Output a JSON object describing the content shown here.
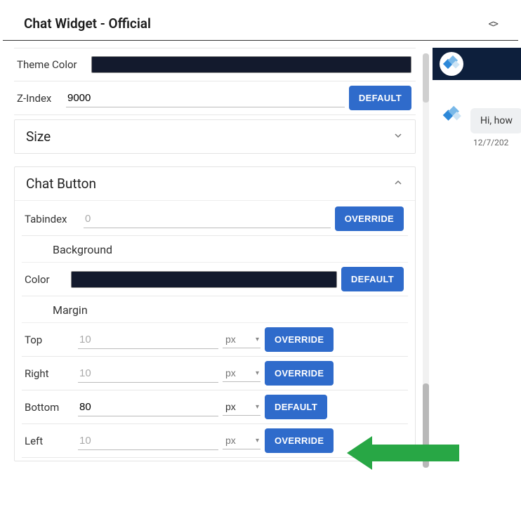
{
  "header": {
    "title": "Chat Widget - Official"
  },
  "fields": {
    "theme_color_label": "Theme Color",
    "theme_color_value": "#131a2d",
    "zindex_label": "Z-Index",
    "zindex_value": "9000",
    "zindex_btn": "DEFAULT"
  },
  "sections": {
    "size": {
      "title": "Size",
      "expanded": false
    },
    "chat_button": {
      "title": "Chat Button",
      "expanded": true,
      "tabindex_label": "Tabindex",
      "tabindex_placeholder": "0",
      "tabindex_btn": "OVERRIDE",
      "background_heading": "Background",
      "bg_color_label": "Color",
      "bg_color_value": "#131a2d",
      "bg_color_btn": "DEFAULT",
      "margin_heading": "Margin",
      "margins": {
        "top": {
          "label": "Top",
          "value_placeholder": "10",
          "unit_placeholder": "px",
          "btn": "OVERRIDE"
        },
        "right": {
          "label": "Right",
          "value_placeholder": "10",
          "unit_placeholder": "px",
          "btn": "OVERRIDE"
        },
        "bottom": {
          "label": "Bottom",
          "value": "80",
          "unit": "px",
          "btn": "DEFAULT"
        },
        "left": {
          "label": "Left",
          "value_placeholder": "10",
          "unit_placeholder": "px",
          "btn": "OVERRIDE"
        }
      }
    }
  },
  "preview": {
    "message": "Hi, how",
    "timestamp": "12/7/202"
  },
  "colors": {
    "accent": "#2f6bcb",
    "swatch": "#131a2d",
    "arrow": "#28a745"
  }
}
